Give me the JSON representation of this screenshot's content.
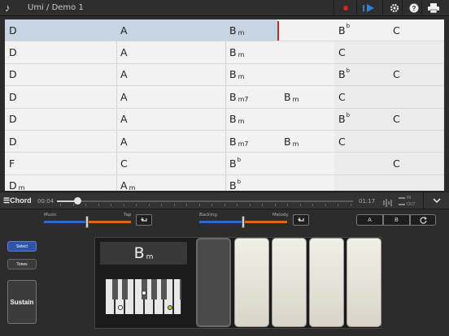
{
  "app": {
    "title": "Umi / Demo 1"
  },
  "toolbar": {
    "record_icon": "record-icon",
    "play_icon": "play-icon",
    "settings_icon": "gear-icon",
    "help_icon": "question-icon",
    "print_icon": "printer-icon",
    "help_glyph": "?"
  },
  "grid": {
    "rows": [
      {
        "cells": [
          {
            "root": "D",
            "q": "",
            "acc": ""
          },
          {
            "root": "A",
            "q": "",
            "acc": ""
          },
          {
            "root": "B",
            "q": "m",
            "acc": ""
          },
          {
            "root": "",
            "q": "",
            "acc": ""
          },
          {
            "root": "B",
            "q": "",
            "acc": "b"
          },
          {
            "root": "C",
            "q": "",
            "acc": ""
          }
        ]
      },
      {
        "cells": [
          {
            "root": "D",
            "q": "",
            "acc": ""
          },
          {
            "root": "A",
            "q": "",
            "acc": ""
          },
          {
            "root": "B",
            "q": "m",
            "acc": ""
          },
          {
            "root": "",
            "q": "",
            "acc": ""
          },
          {
            "root": "C",
            "q": "",
            "acc": ""
          },
          {
            "root": "",
            "q": "",
            "acc": ""
          }
        ]
      },
      {
        "cells": [
          {
            "root": "D",
            "q": "",
            "acc": ""
          },
          {
            "root": "A",
            "q": "",
            "acc": ""
          },
          {
            "root": "B",
            "q": "m",
            "acc": ""
          },
          {
            "root": "",
            "q": "",
            "acc": ""
          },
          {
            "root": "B",
            "q": "",
            "acc": "b"
          },
          {
            "root": "C",
            "q": "",
            "acc": ""
          }
        ]
      },
      {
        "cells": [
          {
            "root": "D",
            "q": "",
            "acc": ""
          },
          {
            "root": "A",
            "q": "",
            "acc": ""
          },
          {
            "root": "B",
            "q": "m7",
            "acc": ""
          },
          {
            "root": "B",
            "q": "m",
            "acc": ""
          },
          {
            "root": "C",
            "q": "",
            "acc": ""
          },
          {
            "root": "",
            "q": "",
            "acc": ""
          }
        ]
      },
      {
        "cells": [
          {
            "root": "D",
            "q": "",
            "acc": ""
          },
          {
            "root": "A",
            "q": "",
            "acc": ""
          },
          {
            "root": "B",
            "q": "m",
            "acc": ""
          },
          {
            "root": "",
            "q": "",
            "acc": ""
          },
          {
            "root": "B",
            "q": "",
            "acc": "b"
          },
          {
            "root": "C",
            "q": "",
            "acc": ""
          }
        ]
      },
      {
        "cells": [
          {
            "root": "D",
            "q": "",
            "acc": ""
          },
          {
            "root": "A",
            "q": "",
            "acc": ""
          },
          {
            "root": "B",
            "q": "m7",
            "acc": ""
          },
          {
            "root": "B",
            "q": "m",
            "acc": ""
          },
          {
            "root": "C",
            "q": "",
            "acc": ""
          },
          {
            "root": "",
            "q": "",
            "acc": ""
          }
        ]
      },
      {
        "cells": [
          {
            "root": "F",
            "q": "",
            "acc": ""
          },
          {
            "root": "C",
            "q": "",
            "acc": ""
          },
          {
            "root": "B",
            "q": "",
            "acc": "b"
          },
          {
            "root": "",
            "q": "",
            "acc": ""
          },
          {
            "root": "",
            "q": "",
            "acc": ""
          },
          {
            "root": "C",
            "q": "",
            "acc": ""
          }
        ]
      },
      {
        "cells": [
          {
            "root": "D",
            "q": "m",
            "acc": ""
          },
          {
            "root": "A",
            "q": "m",
            "acc": ""
          },
          {
            "root": "B",
            "q": "",
            "acc": "b"
          },
          {
            "root": "",
            "q": "",
            "acc": ""
          },
          {
            "root": "",
            "q": "",
            "acc": ""
          },
          {
            "root": "",
            "q": "",
            "acc": ""
          }
        ]
      }
    ]
  },
  "transport": {
    "mode_label": "Chord",
    "time_current": "00:04",
    "time_total": "01:17",
    "progress": 0.07,
    "meter_top": "IN",
    "meter_bottom": "OUT"
  },
  "controls": {
    "music_label": "Music",
    "tap_label": "Tap",
    "backing_label": "Backing",
    "melody_label": "Melody",
    "section_a": "A",
    "section_b": "B",
    "select_label": "Select",
    "tones_label": "Tones",
    "sustain_label": "Sustain",
    "chord_root": "B",
    "chord_quality": "m"
  }
}
